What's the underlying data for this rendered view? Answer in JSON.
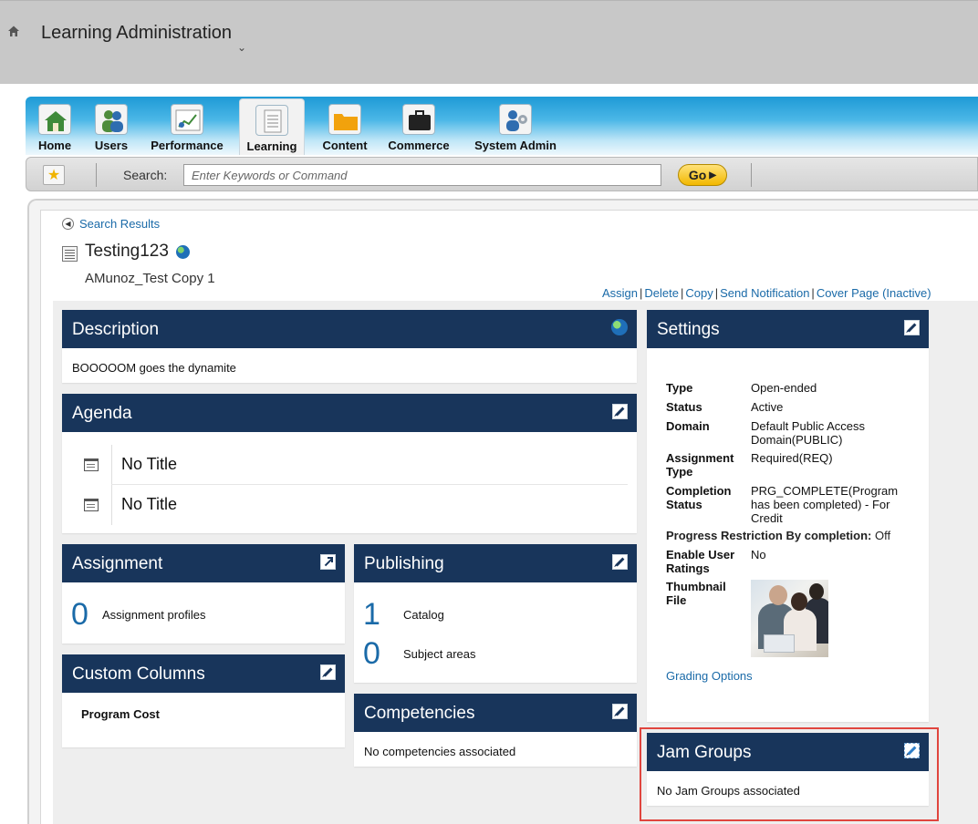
{
  "header": {
    "app_title": "Learning Administration"
  },
  "nav": {
    "items": [
      {
        "label": "Home"
      },
      {
        "label": "Users"
      },
      {
        "label": "Performance"
      },
      {
        "label": "Learning"
      },
      {
        "label": "Content"
      },
      {
        "label": "Commerce"
      },
      {
        "label": "System Admin"
      }
    ],
    "active": "Learning"
  },
  "search": {
    "label": "Search:",
    "placeholder": "Enter Keywords or Command",
    "go_label": "Go"
  },
  "breadcrumb": {
    "back_label": "Search Results"
  },
  "item": {
    "title": "Testing123",
    "subtitle": "AMunoz_Test Copy 1"
  },
  "actions": [
    "Assign",
    "Delete",
    "Copy",
    "Send Notification",
    "Cover Page (Inactive)"
  ],
  "description": {
    "title": "Description",
    "text": "BOOOOOM goes the dynamite"
  },
  "agenda": {
    "title": "Agenda",
    "rows": [
      {
        "text": "No Title"
      },
      {
        "text": "No Title"
      }
    ]
  },
  "assignment": {
    "title": "Assignment",
    "count": "0",
    "label": "Assignment profiles"
  },
  "publishing": {
    "title": "Publishing",
    "catalog_count": "1",
    "catalog_label": "Catalog",
    "subject_count": "0",
    "subject_label": "Subject areas"
  },
  "custom_columns": {
    "title": "Custom Columns",
    "text": "Program Cost"
  },
  "competencies": {
    "title": "Competencies",
    "text": "No competencies associated"
  },
  "settings": {
    "title": "Settings",
    "type_key": "Type",
    "type_val": "Open-ended",
    "status_key": "Status",
    "status_val": "Active",
    "domain_key": "Domain",
    "domain_val": "Default Public Access Domain(PUBLIC)",
    "assignment_type_key": "Assignment Type",
    "assignment_type_val": "Required(REQ)",
    "completion_status_key": "Completion Status",
    "completion_status_val": "PRG_COMPLETE(Program has been completed) - For Credit",
    "progress_key": "Progress Restriction By completion:",
    "progress_val": "Off",
    "ratings_key": "Enable User Ratings",
    "ratings_val": "No",
    "thumbnail_key": "Thumbnail File",
    "grading_link": "Grading Options"
  },
  "jam_groups": {
    "title": "Jam Groups",
    "text": "No Jam Groups associated"
  },
  "colors": {
    "panel_header": "#18355b",
    "link": "#1a6aa8",
    "highlight": "#e0453e",
    "accent_go": "#f2b800"
  }
}
